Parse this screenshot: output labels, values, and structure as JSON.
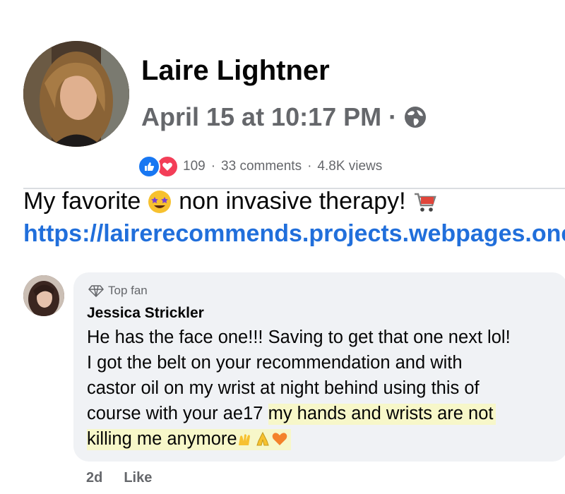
{
  "post": {
    "author": "Laire Lightner",
    "timestamp": "April 15 at 10:17 PM",
    "separator": "·",
    "audience_icon": "globe-icon",
    "reaction_icons": [
      "like-icon",
      "love-icon"
    ],
    "reaction_count": "109",
    "comments_count": "33 comments",
    "views_count": "4.8K views",
    "text_before_emoji": "My favorite",
    "emoji_1": "star-struck-emoji",
    "text_after_emoji": "non invasive therapy!",
    "emoji_2": "shopping-cart-emoji",
    "link": "https://lairerecommends.projects.webpages.one"
  },
  "comment": {
    "badge": "Top fan",
    "badge_icon": "diamond-icon",
    "author": "Jessica Strickler",
    "lines": [
      "He has the face one!!! Saving to get that one next lol!",
      "I got the belt on your recommendation and with",
      "castor oil on my wrist at night behind using this of",
      "course with your ae17"
    ],
    "highlight_1": "my hands and wrists are not",
    "highlight_2": "killing me anymore",
    "end_emojis": [
      "raising-hands-emoji",
      "folded-hands-emoji",
      "orange-heart-emoji"
    ],
    "time": "2d",
    "like_label": "Like"
  },
  "colors": {
    "link": "#216fdb",
    "secondary_text": "#65676b",
    "like_blue": "#1877f2",
    "love_red": "#f33e58",
    "bubble_bg": "#f0f2f5",
    "highlight": "#f7f7c9"
  }
}
